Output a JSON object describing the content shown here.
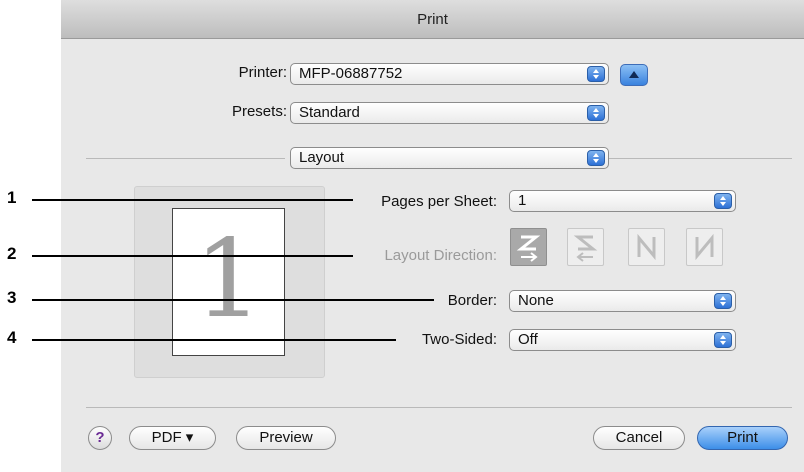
{
  "window": {
    "title": "Print"
  },
  "printer": {
    "label": "Printer:",
    "value": "MFP-06887752"
  },
  "presets": {
    "label": "Presets:",
    "value": "Standard"
  },
  "section": {
    "value": "Layout"
  },
  "preview": {
    "page_number": "1"
  },
  "pages_per_sheet": {
    "label": "Pages per Sheet:",
    "value": "1"
  },
  "layout_direction": {
    "label": "Layout Direction:"
  },
  "border": {
    "label": "Border:",
    "value": "None"
  },
  "two_sided": {
    "label": "Two-Sided:",
    "value": "Off"
  },
  "footer": {
    "help": "?",
    "pdf": "PDF ▾",
    "preview": "Preview",
    "cancel": "Cancel",
    "print": "Print"
  },
  "callouts": [
    "1",
    "2",
    "3",
    "4"
  ],
  "colors": {
    "accent": "#3d8ee8",
    "window_bg": "#e8e8e8"
  },
  "icons": {
    "stepper": "up-down-arrows-icon",
    "disclosure": "triangle-up-icon"
  }
}
